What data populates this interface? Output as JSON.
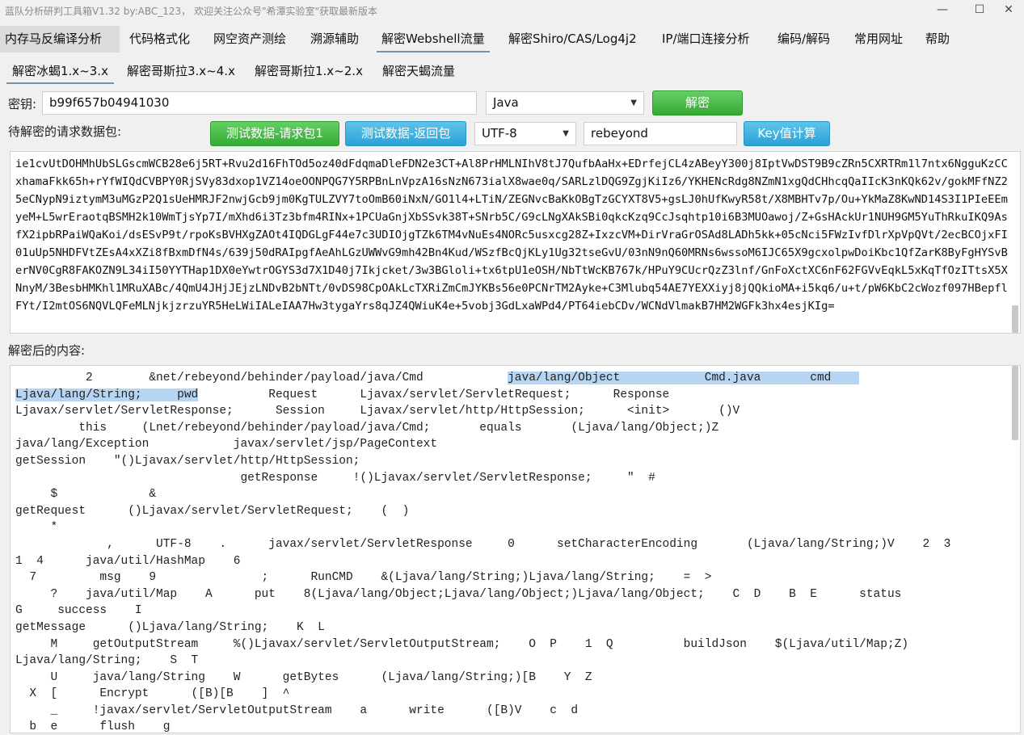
{
  "window": {
    "title": "蓝队分析研判工具箱V1.32 by:ABC_123， 欢迎关注公众号\"希潭实验室\"获取最新版本",
    "btn_min": "—",
    "btn_max": "☐",
    "btn_close": "✕"
  },
  "menu": [
    "内存马反编译分析",
    "代码格式化",
    "网空资产测绘",
    "溯源辅助",
    "解密Webshell流量",
    "解密Shiro/CAS/Log4j2",
    "IP/端口连接分析",
    "编码/解码",
    "常用网址",
    "帮助"
  ],
  "subtabs": [
    "解密冰蝎1.x~3.x",
    "解密哥斯拉3.x~4.x",
    "解密哥斯拉1.x~2.x",
    "解密天蝎流量"
  ],
  "key_label": "密钥:",
  "key_value": "b99f657b04941030",
  "lang_value": "Java",
  "decrypt_button": "解密",
  "request_label": "待解密的请求数据包:",
  "test_req_button": "测试数据-请求包1",
  "test_resp_button": "测试数据-返回包",
  "encoding_value": "UTF-8",
  "password_value": "rebeyond",
  "keycalc_button": "Key值计算",
  "ciphertext": "ie1cvUtDOHMhUbSLGscmWCB28e6j5RT+Rvu2d16FhTOd5oz40dFdqmaDleFDN2e3CT+Al8PrHMLNIhV8tJ7QufbAaHx+EDrfejCL4zABeyY300j8IptVwDST9B9cZRn5CXRTRm1l7ntx6NgguKzCCxhamaFkk65h+rYfWIQdCVBPY0RjSVy83dxop1VZ14oeOONPQG7Y5RPBnLnVpzA16sNzN673ialX8wae0q/SARLzlDQG9ZgjKiIz6/YKHENcRdg8NZmN1xgQdCHhcqQaIIcK3nKQk62v/gokMFfNZ25eCNypN9iztymM3uMGzP2Q1sUeHMRJF2nwjGcb9jm0KgTULZVY7toOmB60iNxN/GO1l4+LTiN/ZEGNvcBaKkOBgTzGCYXT8V5+gsLJ0hUfKwyR58t/X8MBHTv7p/Ou+YkMaZ8KwND14S3I1PIeEEmyeM+L5wrEraotqBSMH2k10WmTjsYp7I/mXhd6i3Tz3bfm4RINx+1PCUaGnjXbSSvk38T+SNrb5C/G9cLNgXAkSBi0qkcKzq9CcJsqhtp10i6B3MUOawoj/Z+GsHAckUr1NUH9GM5YuThRkuIKQ9AsfX2ipbRPaiWQaKoi/dsESvP9t/rpoKsBVHXgZAOt4IQDGLgF44e7c3UDIOjgTZk6TM4vNuEs4NORc5usxcg28Z+IxzcVM+DirVraGrOSAd8LADh5kk+05cNci5FWzIvfDlrXpVpQVt/2ecBCOjxFI01uUp5NHDFVtZEsA4xXZi8fBxmDfN4s/639j50dRAIpgfAeAhLGzUWWvG9mh42Bn4Kud/WSzfBcQjKLy1Ug32tseGvU/03nN9nQ60MRNs6wssoM6IJC65X9gcxolpwDoiKbc1QfZarK8ByFgHYSvBerNV0CgR8FAKOZN9L34iI50YYTHap1DX0eYwtrOGYS3d7X1D40j7Ikjcket/3w3BGloli+tx6tpU1eOSH/NbTtWcKB767k/HPuY9CUcrQzZ3lnf/GnFoXctXC6nF62FGVvEqkL5xKqTfOzITtsX5XNnyM/3BesbHMKhl1MRuXABc/4QmU4JHjJEjzLNDvB2bNTt/0vDS98CpOAkLcTXRiZmCmJYKBs56e0PCNrTM2Ayke+C3Mlubq54AE7YEXXiyj8jQQkioMA+i5kq6/u+t/pW6KbC2cWozf097HBepflFYt/I2mtOS6NQVLQFeMLNjkjzrzuYR5HeLWiIALeIAA7Hw3tygaYrs8qJZ4QWiuK4e+5vobj3GdLxaWPd4/PT64iebCDv/WCNdVlmakB7HM2WGFk3hx4esjKIg=",
  "result_label": "解密后的内容:",
  "plaintext": {
    "l1a": "          2        &net/rebeyond/behinder/payload/java/Cmd            ",
    "l1b": "java/lang/Object            Cmd.java       cmd    ",
    "l2a": "Ljava/lang/String;     pwd",
    "l2b": "          Request      Ljavax/servlet/ServletRequest;      Response",
    "rest": "Ljavax/servlet/ServletResponse;      Session     Ljavax/servlet/http/HttpSession;      <init>       ()V\n         this     (Lnet/rebeyond/behinder/payload/java/Cmd;       equals       (Ljava/lang/Object;)Z\njava/lang/Exception            javax/servlet/jsp/PageContext\ngetSession    \"()Ljavax/servlet/http/HttpSession;\n                                getResponse     !()Ljavax/servlet/ServletResponse;     \"  #\n     $             &\ngetRequest      ()Ljavax/servlet/ServletRequest;    (  )\n     *\n             ,      UTF-8    .      javax/servlet/ServletResponse     0      setCharacterEncoding       (Ljava/lang/String;)V    2  3\n1  4      java/util/HashMap    6\n  7         msg    9               ;      RunCMD    &(Ljava/lang/String;)Ljava/lang/String;    =  >\n     ?    java/util/Map    A      put    8(Ljava/lang/Object;Ljava/lang/Object;)Ljava/lang/Object;    C  D    B  E      status\nG     success    I\ngetMessage      ()Ljava/lang/String;    K  L\n     M     getOutputStream     %()Ljavax/servlet/ServletOutputStream;    O  P    1  Q          buildJson    $(Ljava/util/Map;Z)\nLjava/lang/String;    S  T\n     U     java/lang/String    W      getBytes      (Ljava/lang/String;)[B    Y  Z\n  X  [      Encrypt      ([B)[B    ]  ^\n     _     !javax/servlet/ServletOutputStream    a      write      ([B)V    c  d\n  b  e      flush    g"
  }
}
